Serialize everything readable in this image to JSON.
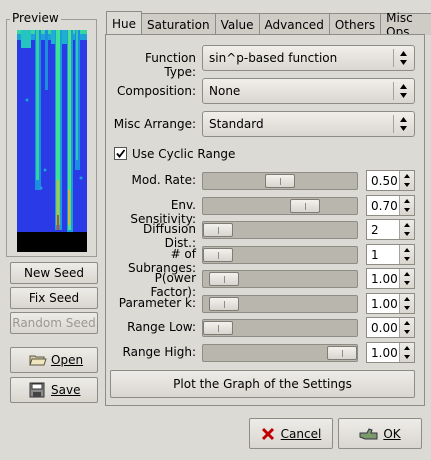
{
  "preview": {
    "label": "Preview"
  },
  "left_buttons": {
    "new_seed": "New Seed",
    "fix_seed": "Fix Seed",
    "random_seed": "Random Seed",
    "open": "Open",
    "save": "Save"
  },
  "tabs": [
    {
      "label": "Hue",
      "active": true
    },
    {
      "label": "Saturation",
      "active": false
    },
    {
      "label": "Value",
      "active": false
    },
    {
      "label": "Advanced",
      "active": false
    },
    {
      "label": "Others",
      "active": false
    },
    {
      "label": "Misc Ops.",
      "active": false
    }
  ],
  "function_type": {
    "label": "Function Type:",
    "value": "sin^p-based function"
  },
  "composition": {
    "label": "Composition:",
    "value": "None"
  },
  "misc_arrange": {
    "label": "Misc Arrange:",
    "value": "Standard"
  },
  "cyclic": {
    "label": "Use Cyclic Range",
    "checked": true
  },
  "sliders": [
    {
      "label": "Mod. Rate:",
      "value": "0.50",
      "level": 0.5
    },
    {
      "label": "Env. Sensitivity:",
      "value": "0.70",
      "level": 0.7
    },
    {
      "label": "Diffusion Dist.:",
      "value": "2",
      "level": 0.0
    },
    {
      "label": "# of Subranges:",
      "value": "1",
      "level": 0.0
    },
    {
      "label": "P(ower Factor):",
      "value": "1.00",
      "level": 0.05
    },
    {
      "label": "Parameter k:",
      "value": "1.00",
      "level": 0.05
    },
    {
      "label": "Range Low:",
      "value": "0.00",
      "level": 0.0
    },
    {
      "label": "Range High:",
      "value": "1.00",
      "level": 1.0
    }
  ],
  "plot_button": "Plot the Graph of the Settings",
  "dialog_buttons": {
    "cancel": "Cancel",
    "ok": "OK"
  }
}
